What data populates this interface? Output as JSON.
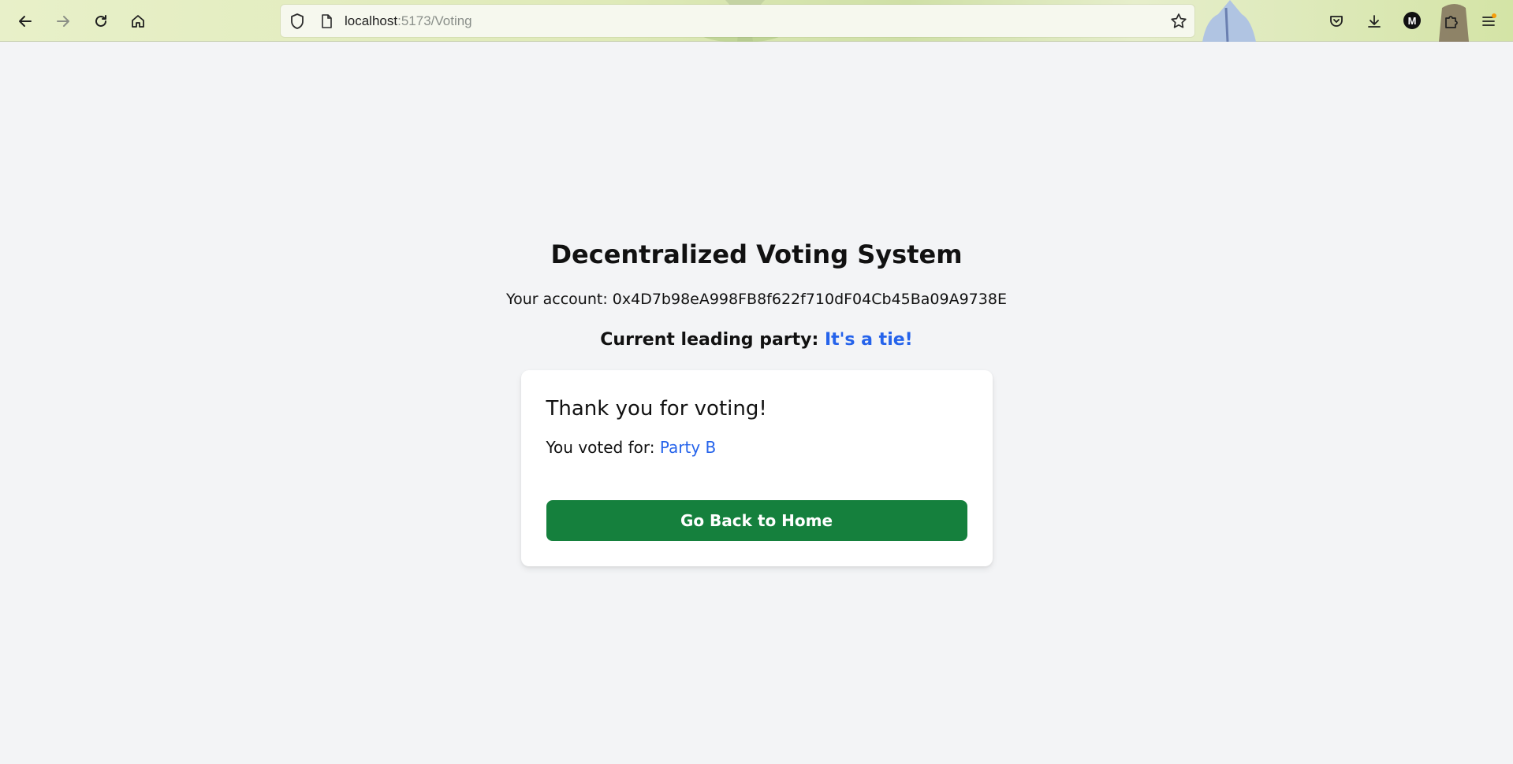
{
  "browser": {
    "url_host": "localhost",
    "url_path": ":5173/Voting",
    "profile_initial": "M"
  },
  "page": {
    "title": "Decentralized Voting System",
    "account_label": "Your account: ",
    "account_address": "0x4D7b98eA998FB8f622f710dF04Cb45Ba09A9738E",
    "leading_label": "Current leading party: ",
    "leading_value": "It's a tie!"
  },
  "card": {
    "heading": "Thank you for voting!",
    "voted_label": "You voted for: ",
    "voted_party": "Party B",
    "button_label": "Go Back to Home"
  },
  "colors": {
    "accent_blue": "#2563eb",
    "button_green": "#15803d",
    "page_bg": "#f3f4f6"
  }
}
